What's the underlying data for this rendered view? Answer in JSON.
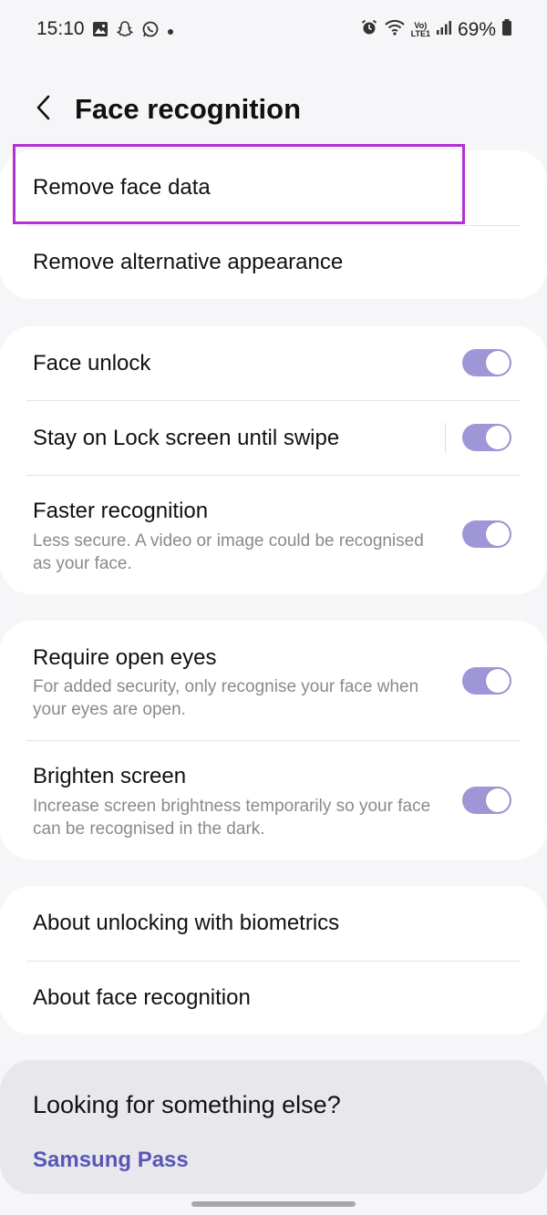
{
  "status_bar": {
    "time": "15:10",
    "volte_top": "Vo)",
    "volte_bottom": "LTE1",
    "battery_percent": "69%"
  },
  "header": {
    "title": "Face recognition"
  },
  "face_data_section": {
    "remove_face_data": "Remove face data",
    "remove_alternative_appearance": "Remove alternative appearance"
  },
  "unlock_section": {
    "face_unlock": {
      "title": "Face unlock",
      "enabled": true
    },
    "stay_on_lock_screen": {
      "title": "Stay on Lock screen until swipe",
      "enabled": true
    },
    "faster_recognition": {
      "title": "Faster recognition",
      "subtitle": "Less secure. A video or image could be recognised as your face.",
      "enabled": true
    }
  },
  "security_section": {
    "require_open_eyes": {
      "title": "Require open eyes",
      "subtitle": "For added security, only recognise your face when your eyes are open.",
      "enabled": true
    },
    "brighten_screen": {
      "title": "Brighten screen",
      "subtitle": "Increase screen brightness temporarily so your face can be recognised in the dark.",
      "enabled": true
    }
  },
  "about_section": {
    "about_biometrics": "About unlocking with biometrics",
    "about_face_recognition": "About face recognition"
  },
  "suggestions": {
    "title": "Looking for something else?",
    "link": "Samsung Pass"
  },
  "colors": {
    "toggle_on": "#9e96d6",
    "highlight": "#b430d6",
    "link": "#5856b8"
  }
}
